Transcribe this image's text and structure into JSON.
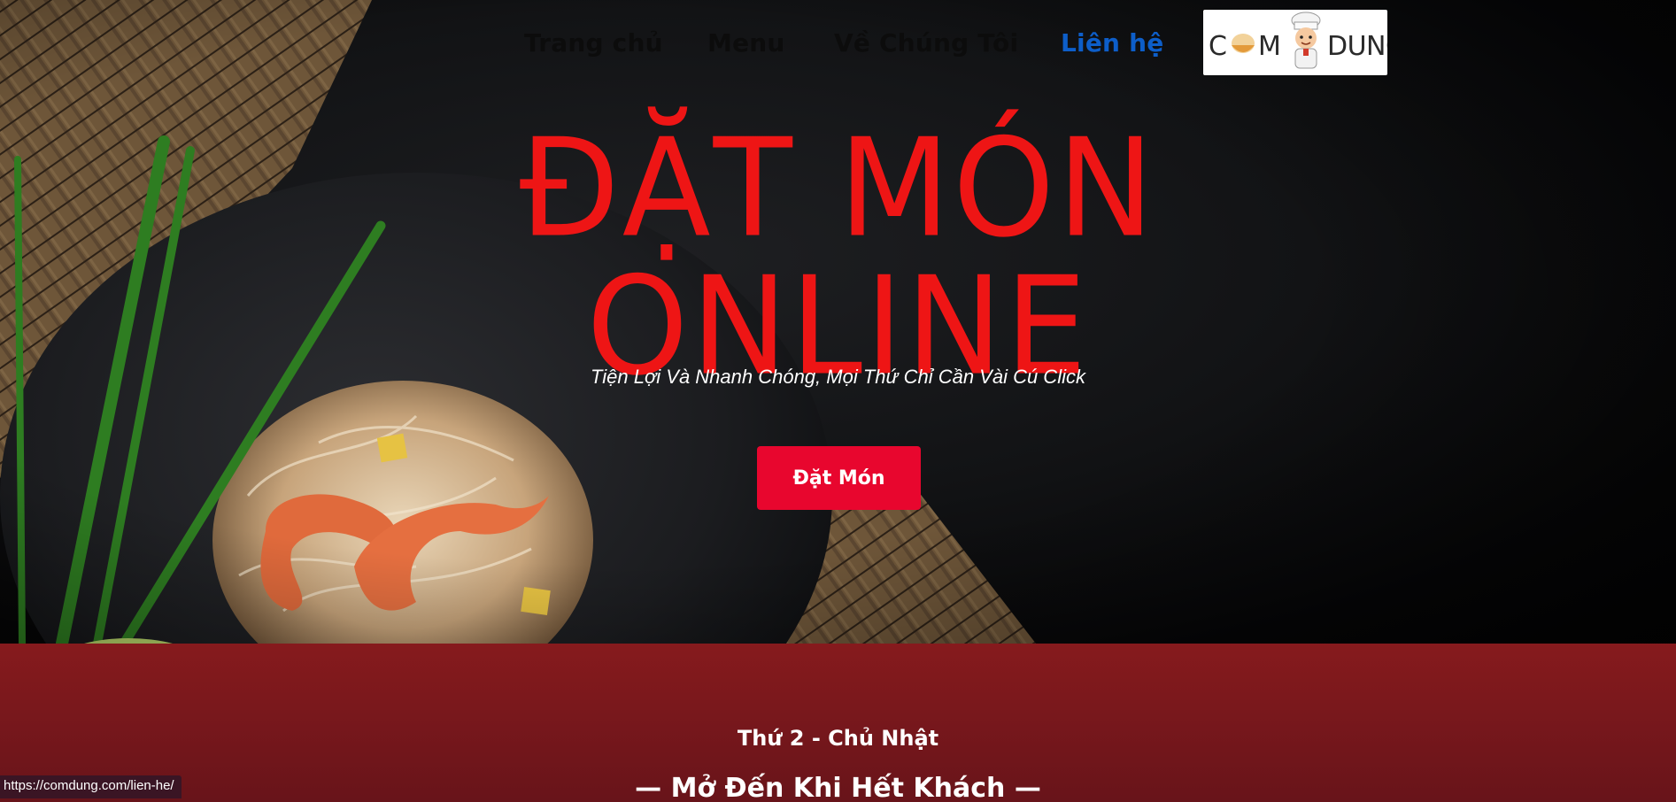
{
  "nav": {
    "items": [
      {
        "label": "Trang chủ"
      },
      {
        "label": "Menu"
      },
      {
        "label": "Về Chúng Tôi"
      },
      {
        "label": "Liên hệ"
      }
    ],
    "logo_text_left": "C",
    "logo_text_mid": "M",
    "logo_text_right": "DUNG"
  },
  "hero": {
    "title_line1": "ĐẶT MÓN",
    "title_line2": "ONLINE",
    "subtitle": "Tiện Lợi Và Nhanh Chóng, Mọi Thứ Chỉ Cần Vài Cú Click",
    "cta_label": "Đặt Món"
  },
  "hours": {
    "days": "Thứ 2 - Chủ Nhật",
    "open": "— Mở Đến Khi Hết Khách —"
  },
  "status_bar": {
    "url": "https://comdung.com/lien-he/"
  },
  "colors": {
    "title_red": "#ee1515",
    "cta_red": "#e8062e",
    "active_link": "#0d5ec9",
    "hours_band": "#7a181c"
  }
}
